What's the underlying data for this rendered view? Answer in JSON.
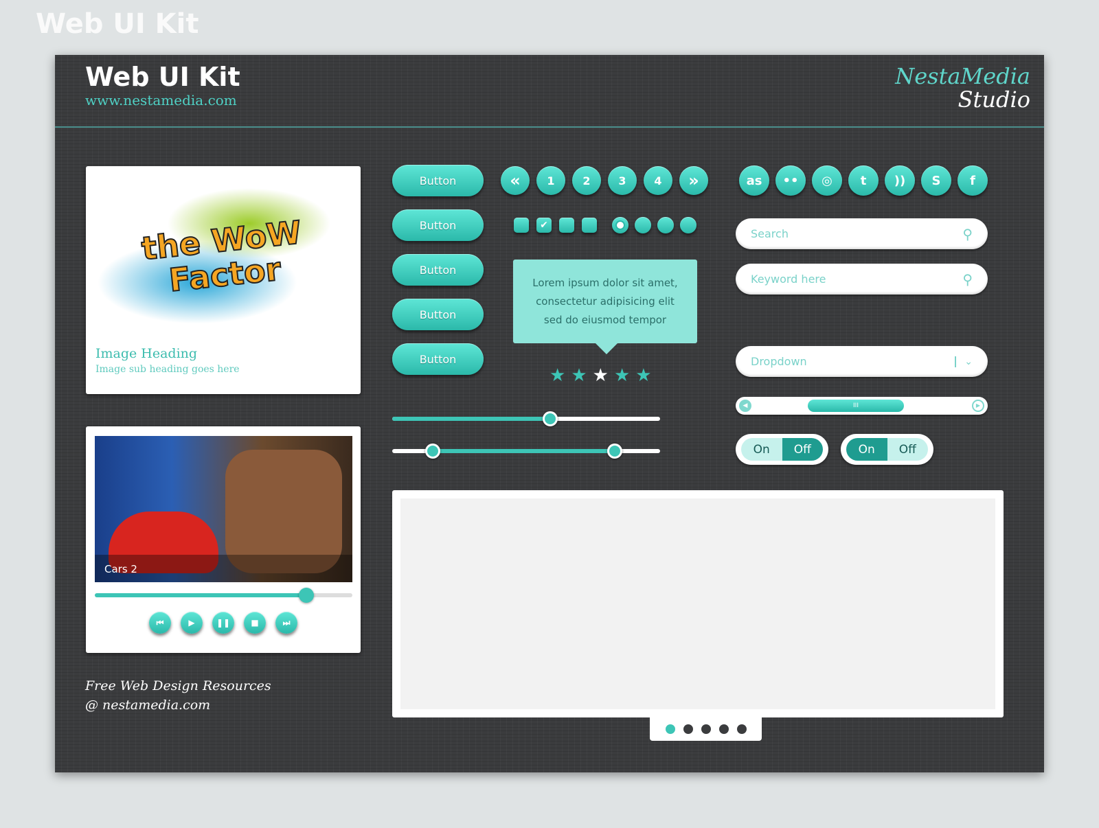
{
  "header": {
    "title": "Web UI Kit",
    "url": "www.nestamedia.com",
    "logo_line1": "NestaMedia",
    "logo_line2": "Studio"
  },
  "image_card": {
    "heading": "Image Heading",
    "subheading": "Image sub heading goes here",
    "art_text": "the WoW Factor"
  },
  "video_card": {
    "caption": "Cars 2",
    "progress_percent": 82,
    "controls": [
      "skip-back",
      "play",
      "pause",
      "stop",
      "skip-forward"
    ]
  },
  "footer": {
    "line1": "Free Web Design Resources",
    "line2": "@ nestamedia.com"
  },
  "buttons": [
    "Button",
    "Button",
    "Button",
    "Button",
    "Button"
  ],
  "pagination": {
    "prev": "«",
    "pages": [
      "1",
      "2",
      "3",
      "4"
    ],
    "next": "»"
  },
  "checkboxes": [
    false,
    true,
    false,
    false
  ],
  "radios": {
    "selected_index": 0,
    "count": 4
  },
  "tooltip": {
    "text": "Lorem ipsum dolor sit amet, consectetur adipisicing elit sed do eiusmod tempor"
  },
  "rating": {
    "stars": 5,
    "highlighted_index": 2
  },
  "slider": {
    "value_percent": 59
  },
  "range_slider": {
    "low_percent": 15,
    "high_percent": 83
  },
  "social": [
    {
      "icon": "lastfm-icon",
      "glyph": "as"
    },
    {
      "icon": "flickr-icon",
      "glyph": "••"
    },
    {
      "icon": "dribbble-icon",
      "glyph": "◎"
    },
    {
      "icon": "twitter-icon",
      "glyph": "t"
    },
    {
      "icon": "rss-icon",
      "glyph": "))"
    },
    {
      "icon": "skype-icon",
      "glyph": "S"
    },
    {
      "icon": "facebook-icon",
      "glyph": "f"
    }
  ],
  "search": {
    "placeholder": "Search"
  },
  "keyword": {
    "placeholder": "Keyword here"
  },
  "dropdown": {
    "value": "Dropdown"
  },
  "scrollbar": {
    "thumb_grip": "III"
  },
  "toggles": [
    {
      "on": "On",
      "off": "Off",
      "state": "off"
    },
    {
      "on": "On",
      "off": "Off",
      "state": "on"
    }
  ],
  "carousel": {
    "dots": 5,
    "active_index": 0
  },
  "colors": {
    "accent": "#3dc5b6",
    "panel": "#3b3c3e",
    "background": "#dfe3e4"
  }
}
